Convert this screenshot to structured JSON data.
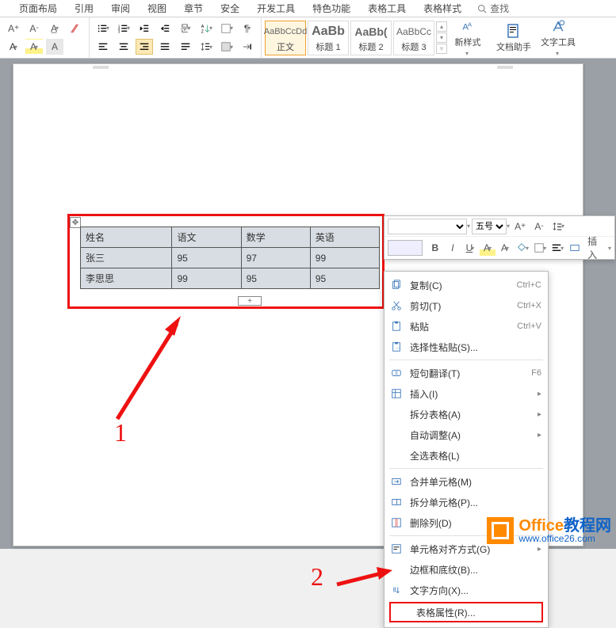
{
  "tabs": [
    "页面布局",
    "引用",
    "审阅",
    "视图",
    "章节",
    "安全",
    "开发工具",
    "特色功能",
    "表格工具",
    "表格样式"
  ],
  "search_placeholder": "查找",
  "styles": {
    "items": [
      {
        "preview": "AaBbCcDd",
        "label": "正文"
      },
      {
        "preview": "AaBb",
        "label": "标题 1"
      },
      {
        "preview": "AaBb(",
        "label": "标题 2"
      },
      {
        "preview": "AaBbCc",
        "label": "标题 3"
      }
    ],
    "new_style": "新样式"
  },
  "big_buttons": {
    "doc_assist": "文档助手",
    "text_tools": "文字工具"
  },
  "mini_toolbar": {
    "font_name": "",
    "font_size": "五号",
    "insert": "插入"
  },
  "table": {
    "headers": [
      "姓名",
      "语文",
      "数学",
      "英语"
    ],
    "rows": [
      [
        "张三",
        "95",
        "97",
        "99"
      ],
      [
        "李思思",
        "99",
        "95",
        "95"
      ]
    ]
  },
  "annotations": {
    "n1": "1",
    "n2": "2"
  },
  "context_menu": [
    {
      "icon": "copy",
      "label": "复制(C)",
      "shortcut": "Ctrl+C"
    },
    {
      "icon": "cut",
      "label": "剪切(T)",
      "shortcut": "Ctrl+X"
    },
    {
      "icon": "paste",
      "label": "粘贴",
      "shortcut": "Ctrl+V"
    },
    {
      "icon": "paste-special",
      "label": "选择性粘贴(S)...",
      "shortcut": ""
    },
    {
      "sep": true
    },
    {
      "icon": "translate",
      "label": "短句翻译(T)",
      "shortcut": "F6"
    },
    {
      "icon": "insert",
      "label": "插入(I)",
      "sub": true
    },
    {
      "icon": "",
      "label": "拆分表格(A)",
      "sub": true
    },
    {
      "icon": "",
      "label": "自动调整(A)",
      "sub": true
    },
    {
      "icon": "",
      "label": "全选表格(L)"
    },
    {
      "sep": true
    },
    {
      "icon": "merge",
      "label": "合并单元格(M)"
    },
    {
      "icon": "split",
      "label": "拆分单元格(P)..."
    },
    {
      "icon": "delcol",
      "label": "删除列(D)"
    },
    {
      "sep": true
    },
    {
      "icon": "align",
      "label": "单元格对齐方式(G)",
      "sub": true
    },
    {
      "icon": "",
      "label": "边框和底纹(B)..."
    },
    {
      "icon": "textdir",
      "label": "文字方向(X)..."
    },
    {
      "icon": "props",
      "label": "表格属性(R)...",
      "boxed": true
    }
  ],
  "watermark": {
    "brand": "Office",
    "suffix": "教程网",
    "url": "www.office26.com"
  }
}
